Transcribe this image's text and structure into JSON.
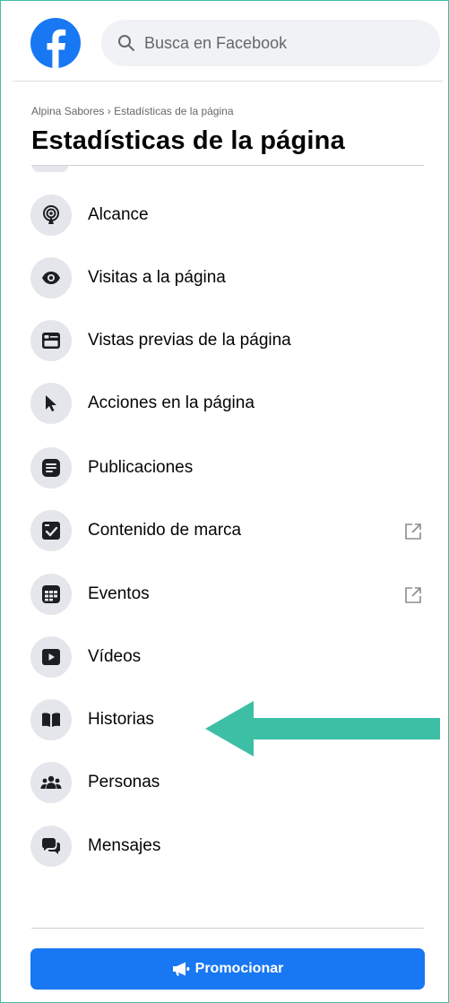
{
  "search": {
    "placeholder": "Busca en Facebook"
  },
  "breadcrumb": {
    "page_name": "Alpina Sabores",
    "separator": "›",
    "current": "Estadísticas de la página"
  },
  "page_title": "Estadísticas de la página",
  "menu": [
    {
      "label": "Alcance",
      "icon": "broadcast-icon"
    },
    {
      "label": "Visitas a la página",
      "icon": "eye-icon"
    },
    {
      "label": "Vistas previas de la página",
      "icon": "page-preview-icon"
    },
    {
      "label": "Acciones en la página",
      "icon": "cursor-icon"
    },
    {
      "label": "Publicaciones",
      "icon": "posts-icon"
    },
    {
      "label": "Contenido de marca",
      "icon": "branded-content-icon",
      "external": true
    },
    {
      "label": "Eventos",
      "icon": "calendar-icon",
      "external": true
    },
    {
      "label": "Vídeos",
      "icon": "video-icon"
    },
    {
      "label": "Historias",
      "icon": "book-icon"
    },
    {
      "label": "Personas",
      "icon": "people-icon"
    },
    {
      "label": "Mensajes",
      "icon": "messages-icon"
    }
  ],
  "promote_button": {
    "label": "Promocionar",
    "icon": "megaphone-icon"
  },
  "annotation": {
    "icon": "arrow-left-icon",
    "color": "#3dbfa5"
  },
  "colors": {
    "brand": "#1877f2",
    "icon_bg": "#e4e6eb",
    "frame": "#3dbfa5"
  }
}
